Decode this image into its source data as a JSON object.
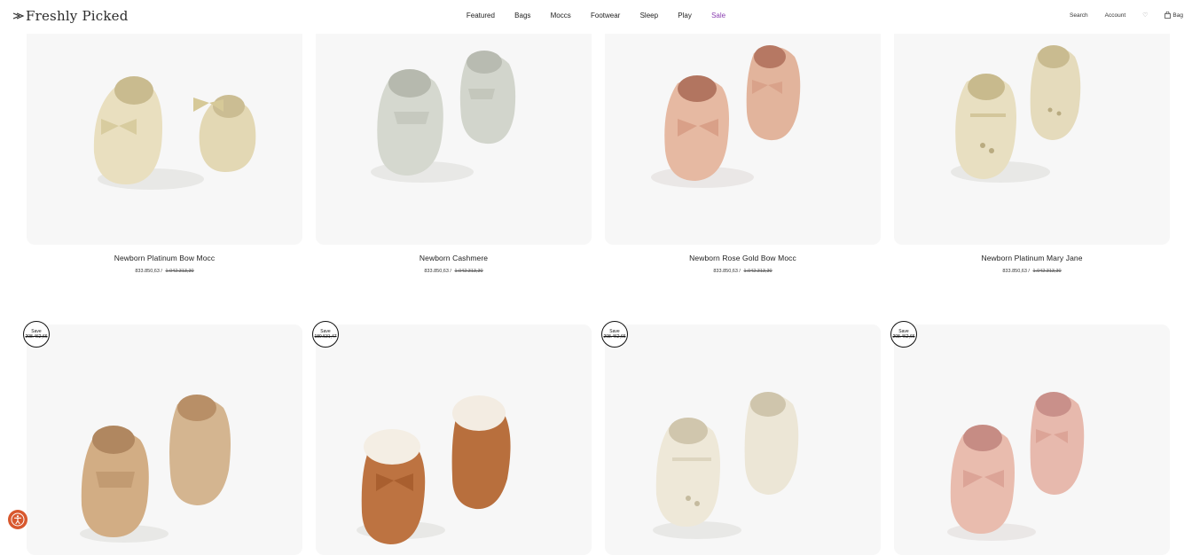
{
  "header": {
    "logo": "Freshly Picked",
    "nav": [
      "Featured",
      "Bags",
      "Moccs",
      "Footwear",
      "Sleep",
      "Play",
      "Sale"
    ],
    "search": "Search",
    "account": "Account",
    "bag": "Bag",
    "colors": {
      "sale": "#8a3fb0"
    }
  },
  "products": [
    {
      "name": "Newborn Platinum Bow Mocc",
      "price": "833.850,63",
      "old_price": "1.042.313,30"
    },
    {
      "name": "Newborn Cashmere",
      "price": "833.850,63",
      "old_price": "1.042.313,30"
    },
    {
      "name": "Newborn Rose Gold Bow Mocc",
      "price": "833.850,63",
      "old_price": "1.042.313,30"
    },
    {
      "name": "Newborn Platinum Mary Jane",
      "price": "833.850,63",
      "old_price": "1.042.313,30"
    }
  ],
  "sale_badges": [
    {
      "label": "Save",
      "amount": "208.462,66"
    },
    {
      "label": "Save",
      "amount": "189.531,47"
    },
    {
      "label": "Save",
      "amount": "208.462,66"
    },
    {
      "label": "Save",
      "amount": "208.462,66"
    }
  ],
  "icons": {
    "logo": "arrow-mark-icon",
    "wishlist": "heart-icon",
    "bag": "shopping-bag-icon",
    "accessibility": "accessibility-icon"
  }
}
